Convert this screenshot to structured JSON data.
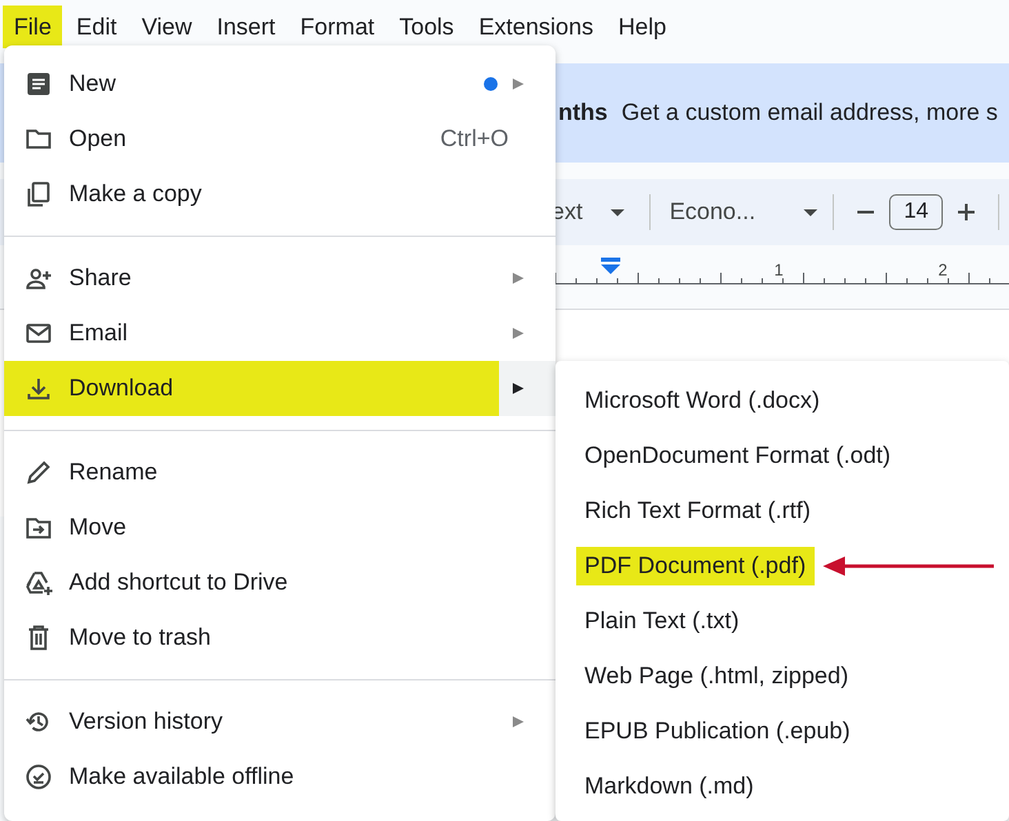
{
  "menubar": [
    {
      "label": "File",
      "selected": true
    },
    {
      "label": "Edit",
      "selected": false
    },
    {
      "label": "View",
      "selected": false
    },
    {
      "label": "Insert",
      "selected": false
    },
    {
      "label": "Format",
      "selected": false
    },
    {
      "label": "Tools",
      "selected": false
    },
    {
      "label": "Extensions",
      "selected": false
    },
    {
      "label": "Help",
      "selected": false
    }
  ],
  "banner": {
    "title": "nths",
    "text": "Get a custom email address, more s"
  },
  "toolbar": {
    "style_dropdown": "ext",
    "font_dropdown": "Econo...",
    "font_size": "14"
  },
  "ruler": {
    "labels": [
      "1",
      "2"
    ]
  },
  "file_menu": {
    "sections": [
      [
        {
          "label": "New",
          "submenu": true,
          "dot": true,
          "selected": false
        },
        {
          "label": "Open",
          "shortcut": "Ctrl+O",
          "submenu": false,
          "dot": false,
          "selected": false
        },
        {
          "label": "Make a copy",
          "submenu": false,
          "dot": false,
          "selected": false
        }
      ],
      [
        {
          "label": "Share",
          "submenu": true,
          "dot": false,
          "selected": false
        },
        {
          "label": "Email",
          "submenu": true,
          "dot": false,
          "selected": false
        },
        {
          "label": "Download",
          "submenu": true,
          "dot": false,
          "selected": true
        }
      ],
      [
        {
          "label": "Rename",
          "submenu": false,
          "dot": false,
          "selected": false
        },
        {
          "label": "Move",
          "submenu": false,
          "dot": false,
          "selected": false
        },
        {
          "label": "Add shortcut to Drive",
          "submenu": false,
          "dot": false,
          "selected": false
        },
        {
          "label": "Move to trash",
          "submenu": false,
          "dot": false,
          "selected": false
        }
      ],
      [
        {
          "label": "Version history",
          "submenu": true,
          "dot": false,
          "selected": false
        },
        {
          "label": "Make available offline",
          "submenu": false,
          "dot": false,
          "selected": false
        }
      ]
    ]
  },
  "download_menu": {
    "items": [
      {
        "label": "Microsoft Word (.docx)",
        "selected": false
      },
      {
        "label": "OpenDocument Format (.odt)",
        "selected": false
      },
      {
        "label": "Rich Text Format (.rtf)",
        "selected": false
      },
      {
        "label": "PDF Document (.pdf)",
        "selected": true
      },
      {
        "label": "Plain Text (.txt)",
        "selected": false
      },
      {
        "label": "Web Page (.html, zipped)",
        "selected": false
      },
      {
        "label": "EPUB Publication (.epub)",
        "selected": false
      },
      {
        "label": "Markdown (.md)",
        "selected": false
      }
    ]
  }
}
